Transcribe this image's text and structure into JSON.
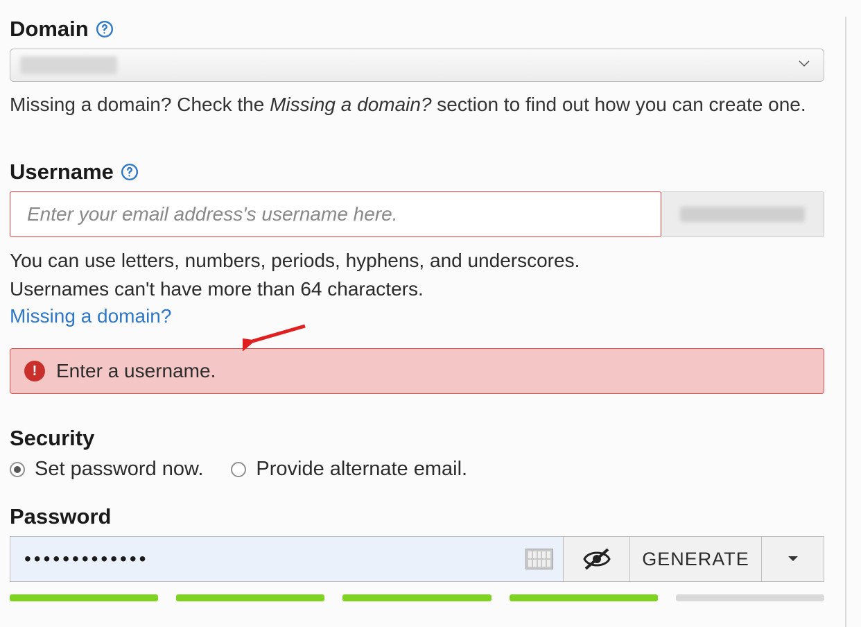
{
  "domain_section": {
    "label": "Domain",
    "help_prefix": "Missing a domain? Check the ",
    "help_em": "Missing a domain?",
    "help_suffix": " section to find out how you can create one."
  },
  "username_section": {
    "label": "Username",
    "placeholder": "Enter your email address's username here.",
    "hint1": "You can use letters, numbers, periods, hyphens, and underscores.",
    "hint2": "Usernames can't have more than 64 characters.",
    "missing_link": "Missing a domain?",
    "error": "Enter a username."
  },
  "security_section": {
    "label": "Security",
    "option_set_now": "Set password now.",
    "option_alt_email": "Provide alternate email.",
    "selected": "set_now"
  },
  "password_section": {
    "label": "Password",
    "value_masked": "•••••••••••••",
    "generate_label": "GENERATE",
    "strength_filled": 4,
    "strength_total": 5
  }
}
